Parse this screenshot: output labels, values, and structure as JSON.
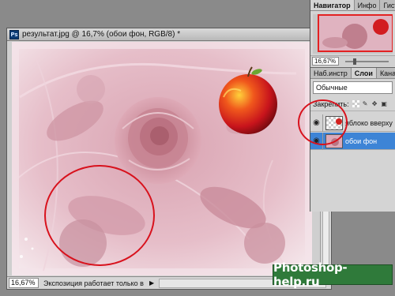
{
  "document": {
    "ps_badge": "Ps",
    "title": "результат.jpg @ 16,7% (обои фон, RGB/8) *",
    "zoom": "16,67%",
    "status_text": "Экспозиция работает только в ...",
    "status_arrow": "▶"
  },
  "navigator_panel": {
    "tabs": [
      "Навигатор",
      "Инфо",
      "Гисто"
    ],
    "zoom": "16,67%"
  },
  "layers_panel": {
    "tabs": [
      "Наб.инстр",
      "Слои",
      "Канал"
    ],
    "blend_mode": "Обычные",
    "lock_label": "Закрепить:",
    "layers": [
      {
        "name": "яблоко вверху",
        "visible": true,
        "selected": false
      },
      {
        "name": "обои фон",
        "visible": true,
        "selected": true
      }
    ]
  },
  "icons": {
    "eye": "eye-icon",
    "lock_transparent": "lock-transparent-icon",
    "lock_paint": "brush-icon",
    "lock_move": "move-icon",
    "lock_all": "lock-icon"
  },
  "colors": {
    "selected_layer": "#3d84d6",
    "highlight_circle": "#d8121d",
    "watermark_bg": "#2f7a3a",
    "canvas_tint": "#e8b8c5"
  },
  "watermark": {
    "text": "Photoshop-help.ru"
  }
}
